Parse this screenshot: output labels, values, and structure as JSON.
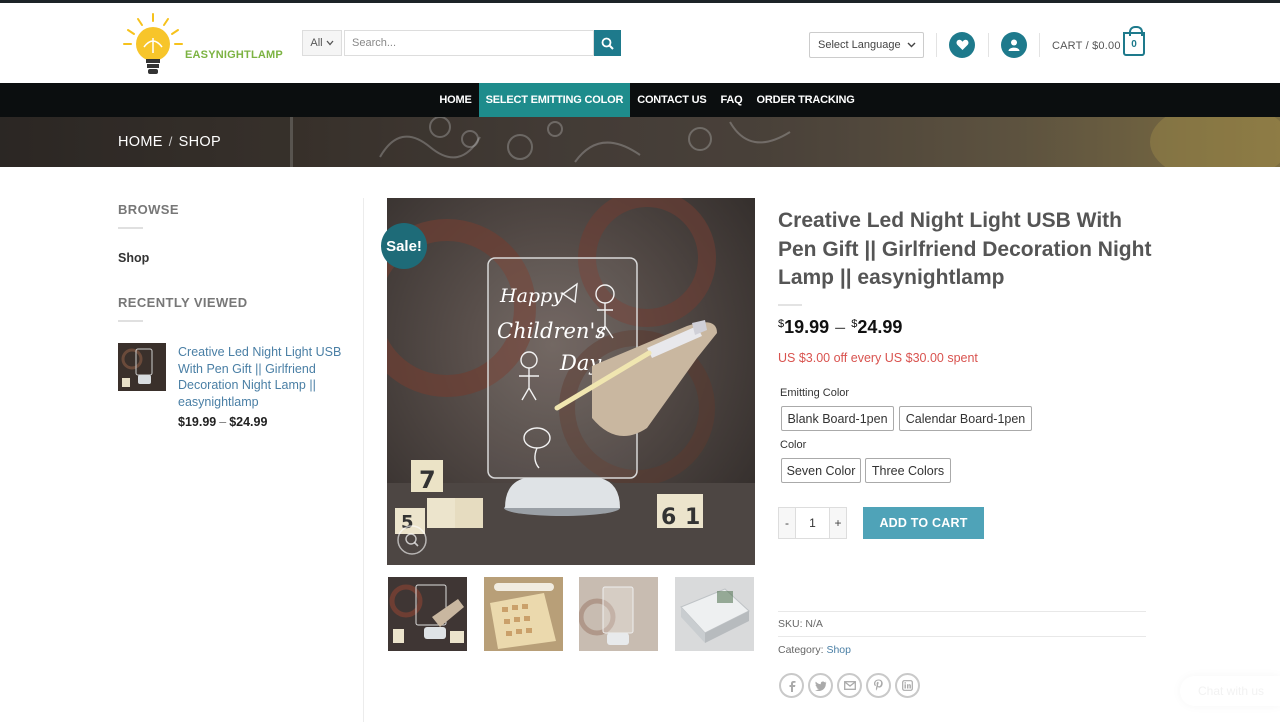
{
  "header": {
    "logo_text": "EASYNIGHTLAMP",
    "search": {
      "category": "All",
      "placeholder": "Search..."
    },
    "language": "Select Language",
    "cart_label": "CART / $0.00",
    "cart_count": "0"
  },
  "nav": {
    "items": [
      {
        "label": "HOME"
      },
      {
        "label": "SELECT EMITTING COLOR"
      },
      {
        "label": "CONTACT US"
      },
      {
        "label": "FAQ"
      },
      {
        "label": "ORDER TRACKING"
      }
    ]
  },
  "breadcrumb": {
    "home": "HOME",
    "sep": "/",
    "current": "SHOP"
  },
  "sidebar": {
    "browse_title": "BROWSE",
    "shop_link": "Shop",
    "recent_title": "RECENTLY VIEWED",
    "recent_item": {
      "title": "Creative Led Night Light USB With Pen Gift || Girlfriend Decoration Night Lamp || easynightlamp",
      "price_min": "$19.99",
      "dash": "–",
      "price_max": "$24.99"
    }
  },
  "gallery": {
    "sale_badge": "Sale!",
    "image_text": {
      "line1": "Happy",
      "line2": "Children's",
      "line3": "Day"
    },
    "blocks": [
      "7",
      "5",
      "6",
      "1"
    ]
  },
  "product": {
    "title": "Creative Led Night Light USB With Pen Gift || Girlfriend Decoration Night Lamp || easynightlamp",
    "price_min": "19.99",
    "price_max": "24.99",
    "currency": "$",
    "dash": "–",
    "promo": "US $3.00 off every US $30.00 spent",
    "emitting_label": "Emitting Color",
    "emitting_options": [
      "Blank Board-1pen",
      "Calendar Board-1pen"
    ],
    "color_label": "Color",
    "color_options": [
      "Seven Color",
      "Three Colors"
    ],
    "qty_minus": "-",
    "qty_value": "1",
    "qty_plus": "+",
    "add_to_cart": "ADD TO CART",
    "sku": "SKU: N/A",
    "category_prefix": "Category:",
    "category_link": "Shop"
  },
  "chat": {
    "label": "Chat with us"
  },
  "colors": {
    "accent": "#1e7a8c",
    "nav_bg": "#0b0e0f",
    "nav_active": "#1e8c8c",
    "add_cart": "#4fa3b8",
    "promo": "#d9534f",
    "link": "#4a7fa5"
  },
  "icons": [
    "search-icon",
    "chevron-down-icon",
    "heart-icon",
    "user-icon",
    "cart-icon",
    "zoom-icon",
    "facebook-icon",
    "twitter-icon",
    "email-icon",
    "pinterest-icon",
    "linkedin-icon"
  ]
}
